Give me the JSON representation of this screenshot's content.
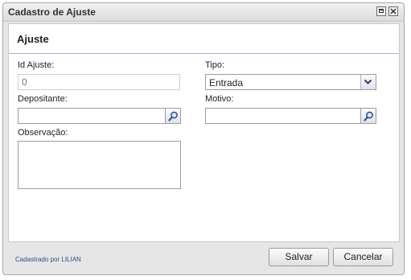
{
  "window": {
    "title": "Cadastro de Ajuste"
  },
  "panel": {
    "title": "Ajuste"
  },
  "fields": {
    "id_label": "Id Ajuste:",
    "id_placeholder": "0",
    "tipo_label": "Tipo:",
    "tipo_value": "Entrada",
    "depositante_label": "Depositante:",
    "depositante_value": "",
    "motivo_label": "Motivo:",
    "motivo_value": "",
    "observacao_label": "Observação:",
    "observacao_value": ""
  },
  "footer": {
    "created_by": "Cadastrado por LILIAN",
    "save_label": "Salvar",
    "cancel_label": "Cancelar"
  }
}
